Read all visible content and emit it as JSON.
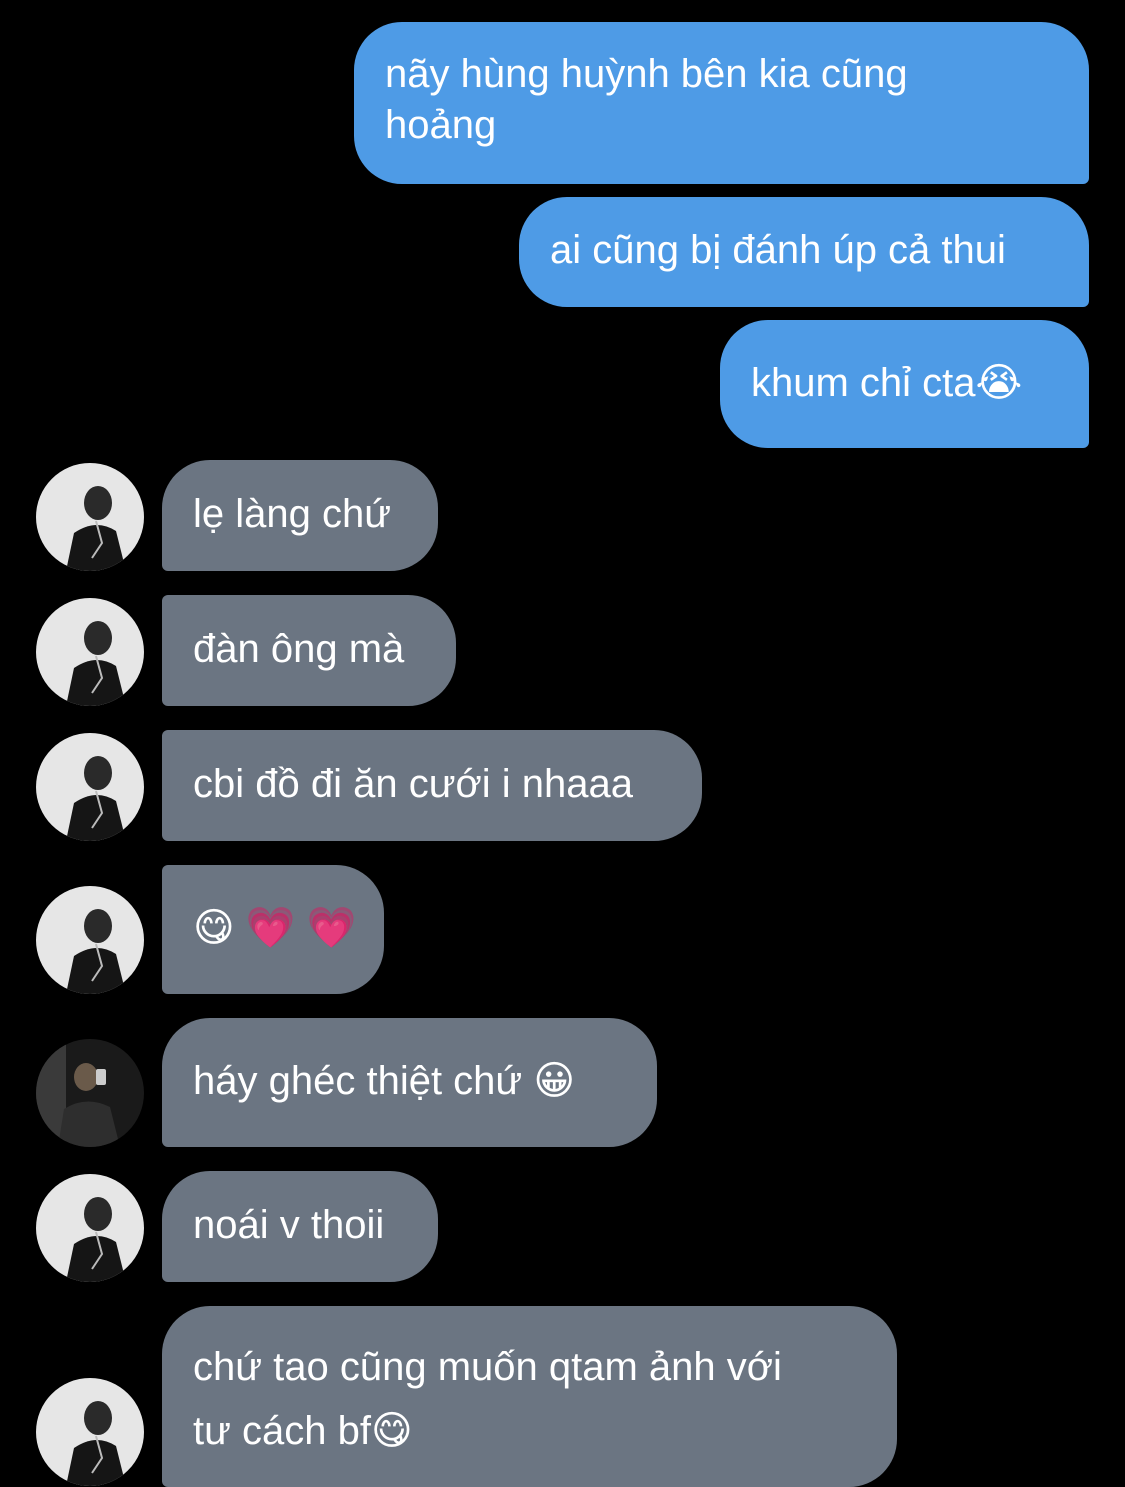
{
  "conversation": {
    "sent_messages": [
      {
        "text_line1": "nãy hùng huỳnh bên kia cũng",
        "text_line2": "hoảng"
      },
      {
        "text": "ai cũng bị đánh úp cả thui"
      },
      {
        "text": "khum chỉ cta😭"
      }
    ],
    "received_messages": [
      {
        "text": "lẹ làng chứ",
        "avatar": "bw-portrait-avatar"
      },
      {
        "text": "đàn ông mà",
        "avatar": "bw-portrait-avatar"
      },
      {
        "text": "cbi đồ đi ăn cưới i nhaaa",
        "avatar": "bw-portrait-avatar"
      },
      {
        "text": "😋 💗 💗",
        "avatar": "bw-portrait-avatar"
      },
      {
        "text": "háy ghéc thiệt chứ 😀",
        "avatar": "mirror-selfie-avatar"
      },
      {
        "text": "noái v thoii",
        "avatar": "bw-portrait-avatar"
      },
      {
        "text_line1": "chứ tao cũng muốn qtam ảnh với",
        "text_line2": "tư cách bf😋",
        "avatar": "bw-portrait-avatar"
      }
    ]
  },
  "colors": {
    "background": "#000000",
    "sent_bubble": "#4e9be6",
    "received_bubble": "#6b7582",
    "text": "#ffffff"
  }
}
